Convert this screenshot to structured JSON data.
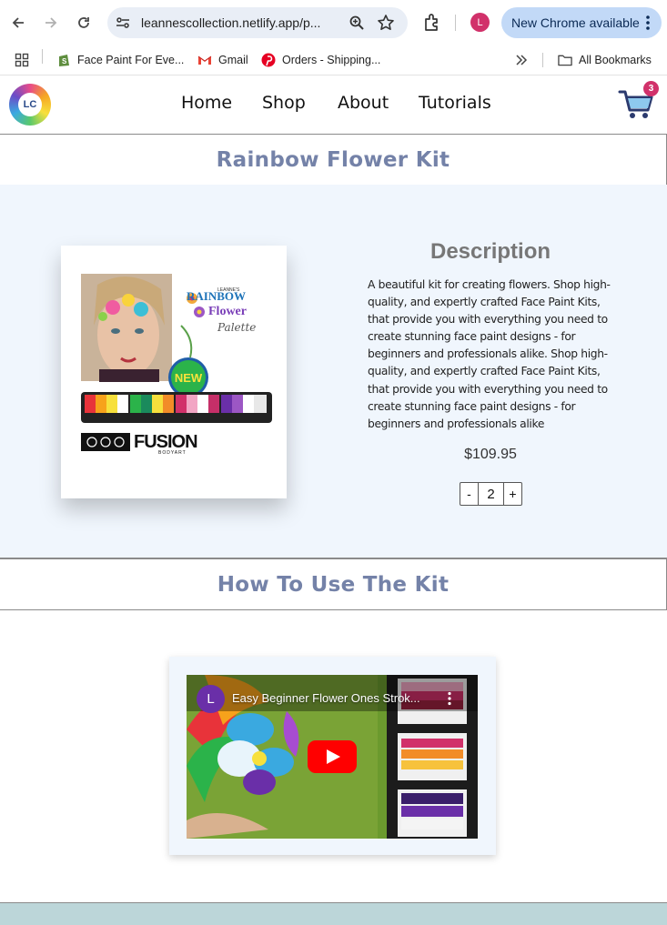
{
  "browser": {
    "url": "leannescollection.netlify.app/p...",
    "profile_initial": "L",
    "update_label": "New Chrome available",
    "bookmarks": [
      {
        "label": "Face Paint For Eve...",
        "icon": "shopify-icon"
      },
      {
        "label": "Gmail",
        "icon": "gmail-icon"
      },
      {
        "label": "Orders - Shipping...",
        "icon": "pinterest-icon"
      }
    ],
    "all_bookmarks_label": "All Bookmarks"
  },
  "site": {
    "logo_text": "LC",
    "nav": [
      "Home",
      "Shop",
      "About",
      "Tutorials"
    ],
    "cart_count": "3"
  },
  "product": {
    "title": "Rainbow Flower Kit",
    "description_heading": "Description",
    "description": "A beautiful kit for creating flowers. Shop high-quality, and expertly crafted Face Paint Kits, that provide you with everything you need to create stunning face paint designs - for beginners and professionals alike. Shop high-quality, and expertly crafted Face Paint Kits, that provide you with everything you need to create stunning face paint designs - for beginners and professionals alike",
    "price": "$109.95",
    "quantity": "2",
    "minus_label": "-",
    "plus_label": "+",
    "image_text": {
      "brand_small": "LEANNE'S",
      "line1": "RAINBOW",
      "line2": "Flower",
      "line3": "Palette",
      "badge": "NEW",
      "maker": "FUSION",
      "maker_sub": "BODYART"
    }
  },
  "howto": {
    "title": "How To Use The Kit",
    "video_title": "Easy Beginner Flower Ones Strok...",
    "channel_initial": "L"
  },
  "colors": {
    "accent_title": "#7482a8",
    "section_bg": "#f0f6fd",
    "badge": "#d1316a",
    "footer": "#bcd6d9"
  }
}
